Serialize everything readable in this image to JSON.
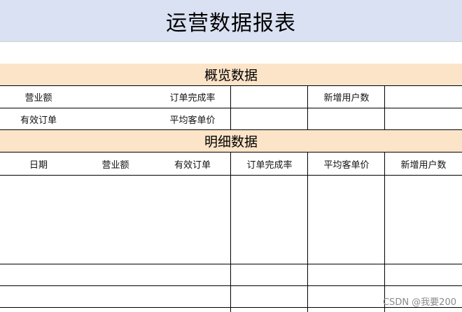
{
  "report": {
    "title": "运营数据报表",
    "overview_title": "概览数据",
    "overview": {
      "revenue_label": "营业额",
      "completion_rate_label": "订单完成率",
      "new_users_label": "新增用户数",
      "valid_orders_label": "有效订单",
      "avg_price_label": "平均客单价"
    },
    "detail_title": "明细数据",
    "detail_columns": [
      "日期",
      "营业额",
      "有效订单",
      "订单完成率",
      "平均客单价",
      "新增用户数"
    ]
  },
  "watermark": "CSDN @我要200",
  "colors": {
    "title_band": "#d9e1f2",
    "section_band": "#fce4c8",
    "grid": "#000000"
  }
}
